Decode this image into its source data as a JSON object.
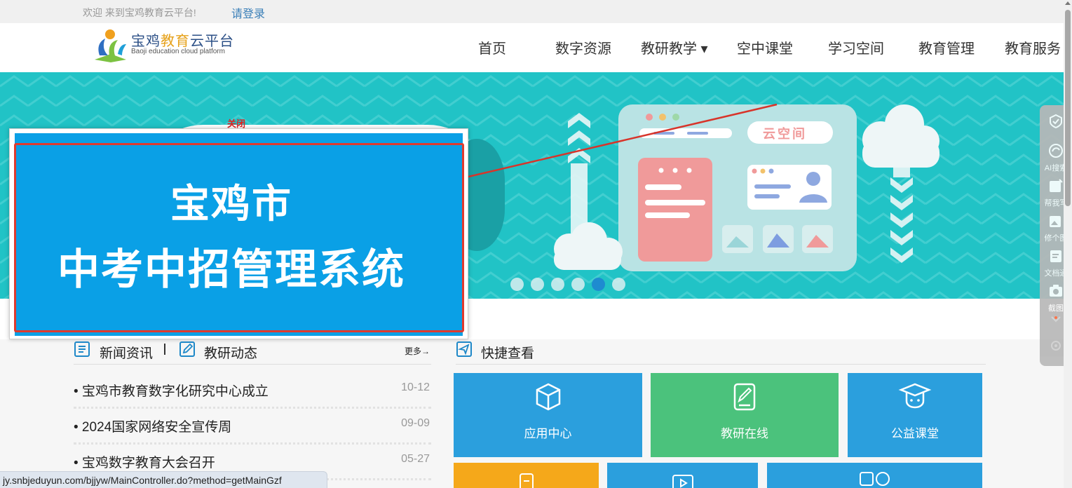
{
  "topbar": {
    "welcome": "欢迎 来到宝鸡教育云平台!",
    "login": "请登录"
  },
  "logo": {
    "cn_part1": "宝鸡",
    "cn_highlight": "教育",
    "cn_part2": "云平台",
    "en": "Baoji education cloud platform"
  },
  "nav": {
    "items": [
      "首页",
      "数字资源",
      "教研教学 ▾",
      "空中课堂",
      "学习空间",
      "教育管理",
      "教育服务"
    ]
  },
  "banner": {
    "cloud_space_label": "云空间",
    "slide_count": 6,
    "active_slide": 5
  },
  "popup": {
    "close": "关闭",
    "title_line1": "宝鸡市",
    "title_line2": "中考中招管理系统"
  },
  "news": {
    "tab1": "新闻资讯",
    "tab2": "教研动态",
    "more": "更多→",
    "items": [
      {
        "title": "• 宝鸡市教育数字化研究中心成立",
        "date": "10-12"
      },
      {
        "title": "• 2024国家网络安全宣传周",
        "date": "09-09"
      },
      {
        "title": "• 宝鸡数字教育大会召开",
        "date": "05-27"
      }
    ]
  },
  "quick": {
    "title": "快捷查看",
    "tiles": [
      {
        "label": "应用中心",
        "color": "#2b9fdd"
      },
      {
        "label": "教研在线",
        "color": "#4bc27c"
      },
      {
        "label": "公益课堂",
        "color": "#2b9fdd"
      },
      {
        "label": "",
        "color": "#f5a81a"
      },
      {
        "label": "",
        "color": "#2b9fdd"
      },
      {
        "label": "",
        "color": "#2b9fdd"
      }
    ]
  },
  "floatbar": {
    "items": [
      "AI搜索",
      "帮我写",
      "修个图",
      "文档通",
      "截图"
    ]
  },
  "statusbar": {
    "url": "jy.snbjeduyun.com/bjjyw/MainController.do?method=getMainGzf"
  }
}
